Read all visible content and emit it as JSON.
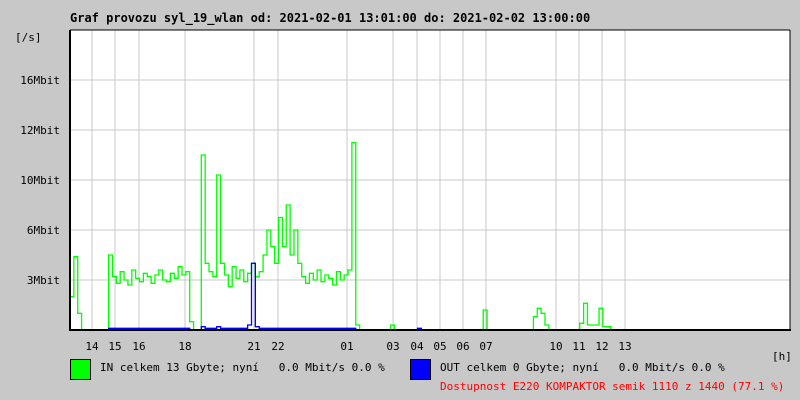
{
  "title": "Graf provozu syl_19_wlan od: 2021-02-01 13:01:00 do: 2021-02-02 13:00:00",
  "chart_data": {
    "type": "line",
    "title": "Graf provozu syl_19_wlan od: 2021-02-01 13:01:00 do: 2021-02-02 13:00:00",
    "ylabel": "[/s]",
    "xlabel": "[h]",
    "sample_interval_minutes": 10,
    "y_ticks": [
      {
        "value": 3,
        "label": "3Mbit"
      },
      {
        "value": 6,
        "label": "6Mbit"
      },
      {
        "value": 10,
        "label": "10Mbit"
      },
      {
        "value": 12,
        "label": "12Mbit"
      },
      {
        "value": 16,
        "label": "16Mbit"
      }
    ],
    "x_ticks": [
      {
        "hours": 1,
        "label": "14"
      },
      {
        "hours": 2,
        "label": "15"
      },
      {
        "hours": 3,
        "label": "16"
      },
      {
        "hours": 5,
        "label": "18"
      },
      {
        "hours": 8,
        "label": "21"
      },
      {
        "hours": 9,
        "label": "22"
      },
      {
        "hours": 12,
        "label": "01"
      },
      {
        "hours": 14,
        "label": "03"
      },
      {
        "hours": 15,
        "label": "04"
      },
      {
        "hours": 16,
        "label": "05"
      },
      {
        "hours": 17,
        "label": "06"
      },
      {
        "hours": 18,
        "label": "07"
      },
      {
        "hours": 21,
        "label": "10"
      },
      {
        "hours": 22,
        "label": "11"
      },
      {
        "hours": 23,
        "label": "12"
      },
      {
        "hours": 24,
        "label": "13"
      }
    ],
    "grid": true,
    "series": [
      {
        "name": "IN",
        "color": "#00ff00",
        "values": [
          2,
          4.4,
          1,
          0,
          0,
          0,
          0,
          0,
          0,
          0,
          4.5,
          3.2,
          2.8,
          3.5,
          3,
          2.7,
          3.6,
          3.1,
          2.9,
          3.4,
          3.2,
          2.8,
          3.3,
          3.6,
          3,
          2.9,
          3.4,
          3.1,
          3.8,
          3.3,
          3.5,
          0.5,
          0,
          0,
          11,
          4,
          3.5,
          3.2,
          10.2,
          4,
          3.3,
          2.6,
          3.8,
          3.1,
          3.6,
          2.9,
          3.4,
          4,
          3.2,
          3.5,
          4.5,
          6,
          5,
          4,
          7,
          5,
          8,
          4.5,
          6,
          4,
          3.2,
          2.8,
          3.4,
          3,
          3.6,
          2.9,
          3.3,
          3.1,
          2.7,
          3.5,
          3,
          3.3,
          3.6,
          11.5,
          0.3,
          0,
          0,
          0,
          0,
          0,
          0,
          0,
          0,
          0.3,
          0,
          0,
          0,
          0,
          0,
          0,
          0,
          0,
          0,
          0,
          0,
          0,
          0,
          0,
          0,
          0,
          0,
          0,
          0,
          0,
          0,
          0,
          0,
          1.2,
          0,
          0,
          0,
          0,
          0,
          0,
          0,
          0,
          0,
          0,
          0,
          0,
          0.8,
          1.3,
          1,
          0.3,
          0,
          0,
          0,
          0,
          0,
          0,
          0,
          0,
          0.4,
          1.6,
          0.3,
          0.3,
          0.3,
          1.3,
          0.2,
          0.2,
          0,
          0,
          0,
          0,
          0,
          0
        ]
      },
      {
        "name": "OUT",
        "color": "#0000ff",
        "values": [
          0,
          0,
          0,
          0,
          0,
          0,
          0,
          0,
          0,
          0,
          0.1,
          0.1,
          0.1,
          0.1,
          0.1,
          0.1,
          0.1,
          0.1,
          0.1,
          0.1,
          0.1,
          0.1,
          0.1,
          0.1,
          0.1,
          0.1,
          0.1,
          0.1,
          0.1,
          0.1,
          0.1,
          0,
          0,
          0,
          0.2,
          0.1,
          0.1,
          0.1,
          0.2,
          0.1,
          0.1,
          0.1,
          0.1,
          0.1,
          0.1,
          0.1,
          0.3,
          4,
          0.2,
          0.1,
          0.1,
          0.1,
          0.1,
          0.1,
          0.1,
          0.1,
          0.1,
          0.1,
          0.1,
          0.1,
          0.1,
          0.1,
          0.1,
          0.1,
          0.1,
          0.1,
          0.1,
          0.1,
          0.1,
          0.1,
          0.1,
          0.1,
          0.1,
          0.1,
          0,
          0,
          0,
          0,
          0,
          0,
          0,
          0,
          0,
          0,
          0,
          0,
          0,
          0,
          0,
          0,
          0.1,
          0,
          0,
          0,
          0,
          0,
          0,
          0,
          0,
          0,
          0,
          0,
          0,
          0,
          0,
          0,
          0,
          0,
          0,
          0,
          0,
          0,
          0,
          0,
          0,
          0,
          0,
          0,
          0,
          0,
          0,
          0,
          0,
          0,
          0,
          0,
          0,
          0,
          0,
          0,
          0,
          0,
          0,
          0,
          0,
          0,
          0,
          0,
          0,
          0,
          0,
          0,
          0,
          0,
          0,
          0
        ]
      }
    ]
  },
  "legend": {
    "in_text": "IN celkem 13 Gbyte; nyní   0.0 Mbit/s 0.0 %",
    "out_text": "OUT celkem 0 Gbyte; nyní   0.0 Mbit/s 0.0 %",
    "availability": "Dostupnost E220 KOMPAKTOR semik 1110 z 1440 (77.1 %)",
    "availability_color": "#ff0000"
  }
}
